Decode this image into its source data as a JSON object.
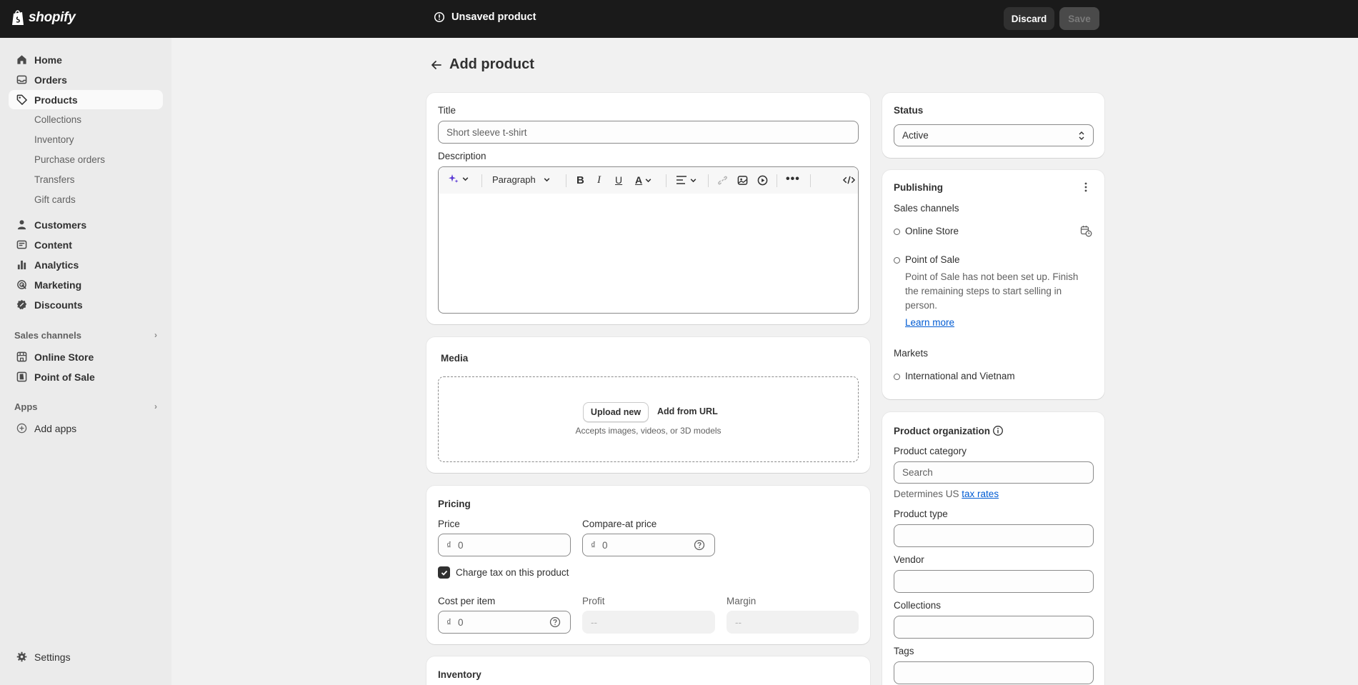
{
  "topbar": {
    "brand": "shopify",
    "status_text": "Unsaved product",
    "discard_label": "Discard",
    "save_label": "Save"
  },
  "sidebar": {
    "items": [
      {
        "label": "Home",
        "icon": "home-icon"
      },
      {
        "label": "Orders",
        "icon": "inbox-icon"
      },
      {
        "label": "Products",
        "icon": "tag-icon",
        "active": true
      },
      {
        "label": "Customers",
        "icon": "person-icon"
      },
      {
        "label": "Content",
        "icon": "content-icon"
      },
      {
        "label": "Analytics",
        "icon": "bar-chart-icon"
      },
      {
        "label": "Marketing",
        "icon": "target-icon"
      },
      {
        "label": "Discounts",
        "icon": "discount-badge-icon"
      }
    ],
    "product_subitems": [
      "Collections",
      "Inventory",
      "Purchase orders",
      "Transfers",
      "Gift cards"
    ],
    "sales_channels_heading": "Sales channels",
    "sales_channels": [
      "Online Store",
      "Point of Sale"
    ],
    "apps_heading": "Apps",
    "add_apps_label": "Add apps",
    "settings_label": "Settings"
  },
  "main": {
    "page_title": "Add product",
    "title_label": "Title",
    "title_placeholder": "Short sleeve t-shirt",
    "description_label": "Description",
    "editor": {
      "format_select": "Paragraph"
    },
    "media": {
      "heading": "Media",
      "upload_label": "Upload new",
      "url_label": "Add from URL",
      "hint": "Accepts images, videos, or 3D models"
    },
    "pricing": {
      "heading": "Pricing",
      "price_label": "Price",
      "compare_label": "Compare-at price",
      "currency_symbol": "₫",
      "price_placeholder": "0",
      "compare_placeholder": "0",
      "charge_tax_label": "Charge tax on this product",
      "charge_tax_checked": true,
      "cost_label": "Cost per item",
      "cost_placeholder": "0",
      "profit_label": "Profit",
      "profit_value": "--",
      "margin_label": "Margin",
      "margin_value": "--"
    },
    "inventory": {
      "heading": "Inventory"
    }
  },
  "right": {
    "status": {
      "heading": "Status",
      "value": "Active"
    },
    "publishing": {
      "heading": "Publishing",
      "sales_channels_label": "Sales channels",
      "online_store": "Online Store",
      "pos": "Point of Sale",
      "pos_note_line1": "Point of Sale has not been set up. Finish",
      "pos_note_line2": "the remaining steps to start selling in",
      "pos_note_line3": "person.",
      "learn_more": "Learn more",
      "markets_label": "Markets",
      "markets_value": "International and Vietnam"
    },
    "organization": {
      "heading": "Product organization",
      "category_label": "Product category",
      "category_placeholder": "Search",
      "determines_prefix": "Determines US",
      "tax_rates_link": "tax rates",
      "type_label": "Product type",
      "vendor_label": "Vendor",
      "collections_label": "Collections",
      "tags_label": "Tags"
    }
  },
  "colors": {
    "topbar_bg": "#1a1a1a",
    "sidebar_bg": "#ebebeb",
    "page_bg": "#f1f1f1",
    "link": "#005bd3"
  }
}
